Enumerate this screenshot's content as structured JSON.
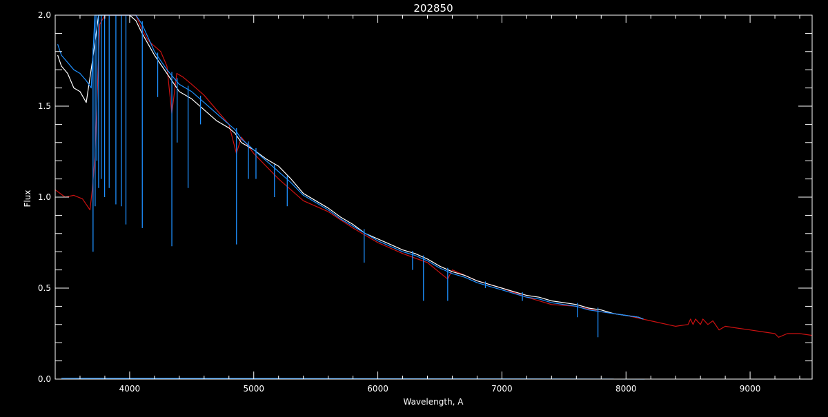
{
  "chart_data": {
    "type": "line",
    "title": "202850",
    "xlabel": "Wavelength, A",
    "ylabel": "Flux",
    "xlim": [
      3400,
      9500
    ],
    "ylim": [
      0.0,
      2.0
    ],
    "xticks": [
      4000,
      5000,
      6000,
      7000,
      8000,
      9000
    ],
    "xtick_labels": [
      "4000",
      "5000",
      "6000",
      "7000",
      "8000",
      "9000"
    ],
    "yticks": [
      0.0,
      0.5,
      1.0,
      1.5,
      2.0
    ],
    "ytick_labels": [
      "0.0",
      "0.5",
      "1.0",
      "1.5",
      "2.0"
    ],
    "grid": false,
    "colors": {
      "background": "#000000",
      "axes": "#ffffff",
      "white_series": "#ffffff",
      "blue_series": "#1e90ff",
      "red_series": "#cc1111"
    },
    "series": [
      {
        "color": "#cc1111",
        "x": [
          3400,
          3480,
          3550,
          3620,
          3680,
          3700,
          3720,
          3760,
          3800,
          3850,
          3900,
          3970,
          4000,
          4050,
          4100,
          4150,
          4200,
          4250,
          4300,
          4340,
          4380,
          4430,
          4500,
          4600,
          4700,
          4800,
          4860,
          4900,
          5000,
          5200,
          5400,
          5600,
          5800,
          6000,
          6200,
          6400,
          6563,
          6600,
          6800,
          7000,
          7200,
          7400,
          7600,
          7800,
          8000,
          8200,
          8400,
          8500,
          8520,
          8540,
          8560,
          8600,
          8620,
          8660,
          8700,
          8750,
          8800,
          8900,
          9000,
          9100,
          9200,
          9230,
          9300,
          9400,
          9500
        ],
        "y": [
          1.04,
          1.0,
          1.01,
          0.99,
          0.93,
          1.05,
          1.22,
          1.95,
          2.0,
          2.0,
          2.0,
          2.0,
          2.0,
          2.0,
          1.92,
          1.86,
          1.83,
          1.8,
          1.72,
          1.46,
          1.68,
          1.66,
          1.62,
          1.56,
          1.48,
          1.4,
          1.24,
          1.33,
          1.24,
          1.1,
          0.98,
          0.92,
          0.83,
          0.75,
          0.69,
          0.64,
          0.55,
          0.6,
          0.54,
          0.5,
          0.45,
          0.41,
          0.4,
          0.37,
          0.35,
          0.32,
          0.29,
          0.3,
          0.33,
          0.3,
          0.33,
          0.3,
          0.33,
          0.3,
          0.32,
          0.27,
          0.29,
          0.28,
          0.27,
          0.26,
          0.25,
          0.23,
          0.25,
          0.25,
          0.24
        ]
      },
      {
        "color": "#ffffff",
        "x": [
          3420,
          3450,
          3500,
          3550,
          3600,
          3650,
          3700,
          3750,
          3800,
          3900,
          4000,
          4050,
          4100,
          4200,
          4300,
          4400,
          4500,
          4600,
          4700,
          4800,
          4850,
          4900,
          5000,
          5100,
          5200,
          5300,
          5400,
          5500,
          5600,
          5700,
          5800,
          5900,
          6000,
          6100,
          6200,
          6300,
          6400,
          6500,
          6600,
          6700,
          6800,
          6900,
          7000,
          7100,
          7200,
          7300,
          7400,
          7500,
          7600,
          7700,
          7800,
          7900,
          8000,
          8100,
          8140
        ],
        "y": [
          1.78,
          1.72,
          1.68,
          1.6,
          1.58,
          1.52,
          1.75,
          2.0,
          2.0,
          2.0,
          2.0,
          1.97,
          1.9,
          1.78,
          1.68,
          1.58,
          1.54,
          1.48,
          1.42,
          1.38,
          1.35,
          1.3,
          1.26,
          1.21,
          1.17,
          1.1,
          1.02,
          0.98,
          0.94,
          0.89,
          0.85,
          0.8,
          0.77,
          0.74,
          0.71,
          0.69,
          0.66,
          0.62,
          0.59,
          0.57,
          0.54,
          0.52,
          0.5,
          0.48,
          0.46,
          0.45,
          0.43,
          0.42,
          0.41,
          0.39,
          0.38,
          0.36,
          0.35,
          0.34,
          0.33
        ]
      },
      {
        "color": "#1e90ff",
        "x": [
          3420,
          3450,
          3500,
          3550,
          3600,
          3650,
          3690,
          3720,
          3750,
          3800,
          3900,
          4000,
          4050,
          4100,
          4200,
          4300,
          4400,
          4500,
          4600,
          4700,
          4800,
          4850,
          4900,
          5000,
          5100,
          5200,
          5300,
          5400,
          5500,
          5600,
          5700,
          5800,
          5900,
          6000,
          6100,
          6200,
          6300,
          6400,
          6500,
          6600,
          6700,
          6800,
          6900,
          7000,
          7100,
          7200,
          7300,
          7400,
          7500,
          7600,
          7700,
          7800,
          7900,
          8000,
          8100,
          8140
        ],
        "y": [
          1.84,
          1.78,
          1.74,
          1.7,
          1.68,
          1.64,
          1.6,
          2.0,
          2.0,
          2.0,
          2.0,
          2.0,
          2.0,
          1.95,
          1.8,
          1.7,
          1.62,
          1.58,
          1.52,
          1.46,
          1.4,
          1.37,
          1.32,
          1.26,
          1.2,
          1.14,
          1.08,
          1.01,
          0.97,
          0.93,
          0.88,
          0.84,
          0.8,
          0.76,
          0.73,
          0.7,
          0.68,
          0.65,
          0.61,
          0.58,
          0.56,
          0.53,
          0.51,
          0.49,
          0.47,
          0.45,
          0.44,
          0.42,
          0.41,
          0.4,
          0.38,
          0.37,
          0.36,
          0.35,
          0.34,
          0.33
        ]
      },
      {
        "color": "#1e90ff",
        "x": [
          3450,
          8150
        ],
        "y": [
          0.005,
          0.0
        ]
      }
    ],
    "absorption_lines": [
      {
        "x": 3705,
        "y": 0.7
      },
      {
        "x": 3722,
        "y": 0.95
      },
      {
        "x": 3736,
        "y": 1.2
      },
      {
        "x": 3750,
        "y": 1.05
      },
      {
        "x": 3771,
        "y": 1.1
      },
      {
        "x": 3798,
        "y": 1.0
      },
      {
        "x": 3835,
        "y": 1.05
      },
      {
        "x": 3889,
        "y": 0.96
      },
      {
        "x": 3933,
        "y": 0.95
      },
      {
        "x": 3970,
        "y": 0.85
      },
      {
        "x": 4102,
        "y": 0.83
      },
      {
        "x": 4226,
        "y": 1.55
      },
      {
        "x": 4340,
        "y": 0.73
      },
      {
        "x": 4383,
        "y": 1.3
      },
      {
        "x": 4471,
        "y": 1.05
      },
      {
        "x": 4571,
        "y": 1.4
      },
      {
        "x": 4861,
        "y": 0.74
      },
      {
        "x": 4957,
        "y": 1.1
      },
      {
        "x": 5018,
        "y": 1.1
      },
      {
        "x": 5167,
        "y": 1.0
      },
      {
        "x": 5270,
        "y": 0.95
      },
      {
        "x": 5890,
        "y": 0.64
      },
      {
        "x": 6280,
        "y": 0.6
      },
      {
        "x": 6368,
        "y": 0.43
      },
      {
        "x": 6563,
        "y": 0.43
      },
      {
        "x": 6867,
        "y": 0.5
      },
      {
        "x": 7165,
        "y": 0.43
      },
      {
        "x": 7608,
        "y": 0.34
      },
      {
        "x": 7774,
        "y": 0.23
      }
    ]
  }
}
